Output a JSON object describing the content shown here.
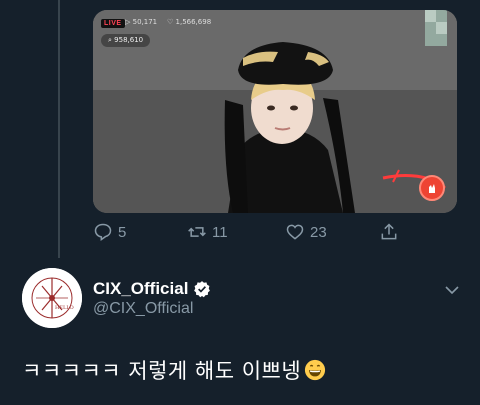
{
  "video": {
    "live_label": "LIVE",
    "views": "50,171",
    "hearts": "1,566,698",
    "chat_count": "958,610"
  },
  "actions": {
    "reply_count": "5",
    "retweet_count": "11",
    "like_count": "23"
  },
  "reply": {
    "display_name": "CIX_Official",
    "handle": "@CIX_Official",
    "text": "ㅋㅋㅋㅋㅋ 저렇게 해도 이쁘넹",
    "avatar_text": "HELLO"
  },
  "colors": {
    "background": "#15202b",
    "muted": "#8899a6",
    "verified": "#ffffff",
    "logo_red": "#9b2c2c"
  },
  "icons": [
    "reply-icon",
    "retweet-icon",
    "like-icon",
    "share-icon",
    "verified-icon",
    "chevron-down-icon",
    "grinning-emoji-icon"
  ]
}
